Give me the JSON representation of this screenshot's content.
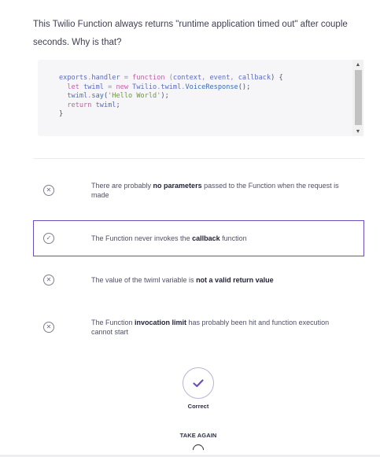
{
  "question": {
    "text": "This Twilio Function always returns \"runtime application timed out\" after couple seconds. Why is that?"
  },
  "code": {
    "lines": [
      [
        {
          "t": "exports",
          "c": "prop"
        },
        {
          "t": ".",
          "c": "op"
        },
        {
          "t": "handler",
          "c": "prop"
        },
        {
          "t": " = ",
          "c": "op"
        },
        {
          "t": "function",
          "c": "kw"
        },
        {
          "t": " (",
          "c": "op"
        },
        {
          "t": "context",
          "c": "prop"
        },
        {
          "t": ", ",
          "c": "op"
        },
        {
          "t": "event",
          "c": "prop"
        },
        {
          "t": ", ",
          "c": "op"
        },
        {
          "t": "callback",
          "c": "prop"
        },
        {
          "t": ") {",
          "c": "plain"
        }
      ],
      [
        {
          "t": "  ",
          "c": "plain"
        },
        {
          "t": "let",
          "c": "kw"
        },
        {
          "t": " twiml ",
          "c": "prop"
        },
        {
          "t": "=",
          "c": "op"
        },
        {
          "t": " new ",
          "c": "kw"
        },
        {
          "t": "Twilio",
          "c": "prop"
        },
        {
          "t": ".",
          "c": "op"
        },
        {
          "t": "twiml",
          "c": "prop"
        },
        {
          "t": ".",
          "c": "op"
        },
        {
          "t": "VoiceResponse",
          "c": "fn"
        },
        {
          "t": "();",
          "c": "plain"
        }
      ],
      [
        {
          "t": "  twiml",
          "c": "prop"
        },
        {
          "t": ".",
          "c": "op"
        },
        {
          "t": "say",
          "c": "fn"
        },
        {
          "t": "(",
          "c": "plain"
        },
        {
          "t": "'Hello World'",
          "c": "str"
        },
        {
          "t": ");",
          "c": "plain"
        }
      ],
      [
        {
          "t": "  ",
          "c": "plain"
        },
        {
          "t": "return",
          "c": "kw"
        },
        {
          "t": " twiml",
          "c": "prop"
        },
        {
          "t": ";",
          "c": "plain"
        }
      ],
      [
        {
          "t": "}",
          "c": "plain"
        }
      ]
    ],
    "scroll_up_icon": "triangle-up",
    "scroll_down_icon": "triangle-down"
  },
  "options": [
    {
      "icon": "x-circle-icon",
      "glyph": "✕",
      "parts": [
        {
          "t": "There are probably ",
          "b": false
        },
        {
          "t": "no parameters",
          "b": true
        },
        {
          "t": " passed to the Function when the request is made",
          "b": false
        }
      ],
      "selected": false
    },
    {
      "icon": "check-circle-icon",
      "glyph": "✓",
      "parts": [
        {
          "t": "The Function never invokes the ",
          "b": false
        },
        {
          "t": "callback",
          "b": true
        },
        {
          "t": " function",
          "b": false
        }
      ],
      "selected": true
    },
    {
      "icon": "x-circle-icon",
      "glyph": "✕",
      "parts": [
        {
          "t": "The value of the twiml variable is ",
          "b": false
        },
        {
          "t": "not a valid return value",
          "b": true
        }
      ],
      "selected": false
    },
    {
      "icon": "x-circle-icon",
      "glyph": "✕",
      "parts": [
        {
          "t": "The Function ",
          "b": false
        },
        {
          "t": "invocation limit",
          "b": true
        },
        {
          "t": " has probably been hit and function execution cannot start",
          "b": false
        }
      ],
      "selected": false
    }
  ],
  "result": {
    "icon": "checkmark-icon",
    "color": "#6c4fbf",
    "label": "Correct"
  },
  "actions": {
    "take_again_label": "TAKE AGAIN",
    "spinner_icon": "loading-spinner-icon"
  },
  "colors": {
    "accent": "#6c4fbf"
  }
}
